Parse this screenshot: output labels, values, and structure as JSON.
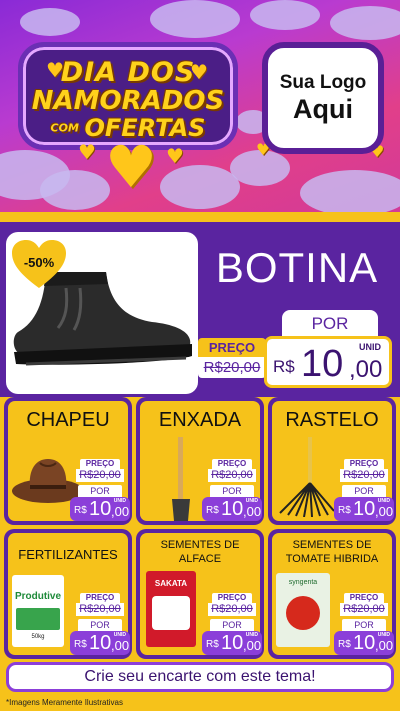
{
  "header": {
    "title_line1": "DIA DOS",
    "title_line2": "NAMORADOS",
    "title_line3a": "COM",
    "title_line3b": "OFERTAS",
    "logo_line1": "Sua Logo",
    "logo_line2": "Aqui"
  },
  "hero": {
    "discount": "-50%",
    "name": "BOTINA",
    "por": "POR",
    "old_label": "PREÇO",
    "old_price": "R$20,00",
    "currency": "R$",
    "price_int": "10",
    "price_cents": ",00",
    "unit": "UNID"
  },
  "products": [
    {
      "name": "CHAPEU",
      "preco": "PREÇO",
      "old": "R$20,00",
      "por": "POR",
      "currency": "R$",
      "int": "10",
      "cents": ",00",
      "unit": "UNID"
    },
    {
      "name": "ENXADA",
      "preco": "PREÇO",
      "old": "R$20,00",
      "por": "POR",
      "currency": "R$",
      "int": "10",
      "cents": ",00",
      "unit": "UNID"
    },
    {
      "name": "RASTELO",
      "preco": "PREÇO",
      "old": "R$20,00",
      "por": "POR",
      "currency": "R$",
      "int": "10",
      "cents": ",00",
      "unit": "UNID"
    },
    {
      "name": "FERTILIZANTES",
      "preco": "PREÇO",
      "old": "R$20,00",
      "por": "POR",
      "currency": "R$",
      "int": "10",
      "cents": ",00",
      "unit": "UNID",
      "pack": "Produtive",
      "pack_weight": "50kg"
    },
    {
      "name_l1": "SEMENTES DE",
      "name_l2": "ALFACE",
      "preco": "PREÇO",
      "old": "R$20,00",
      "por": "POR",
      "currency": "R$",
      "int": "10",
      "cents": ",00",
      "unit": "UNID",
      "pack": "SAKATA"
    },
    {
      "name_l1": "SEMENTES DE",
      "name_l2": "TOMATE HIBRIDA",
      "preco": "PREÇO",
      "old": "R$20,00",
      "por": "POR",
      "currency": "R$",
      "int": "10",
      "cents": ",00",
      "unit": "UNID",
      "pack": "syngenta"
    }
  ],
  "footer": {
    "cta": "Crie seu encarte com este tema!",
    "disclaimer": "*Imagens Meramente Ilustrativas"
  },
  "colors": {
    "purple": "#5a24a0",
    "yellow": "#f6c21a",
    "price_purple": "#8b3fd9"
  }
}
